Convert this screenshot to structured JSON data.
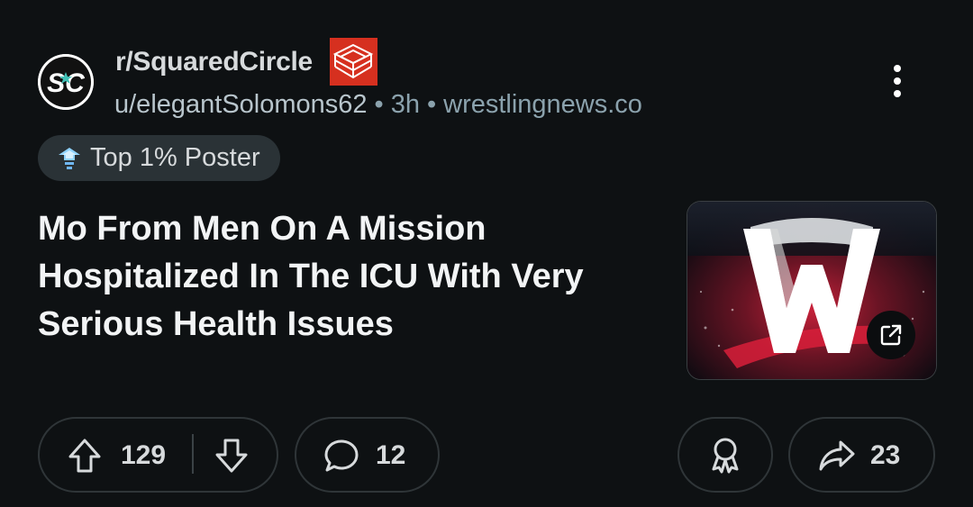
{
  "post": {
    "subreddit": "r/SquaredCircle",
    "author": "u/elegantSolomons62",
    "time": "3h",
    "domain": "wrestlingnews.co",
    "flair": "Top 1% Poster",
    "title": "Mo From Men On A Mission Hospitalized In The ICU With Very Serious Health Issues"
  },
  "actions": {
    "upvotes": "129",
    "comments": "12",
    "shares": "23"
  },
  "icons": {
    "avatar": "sc-logo-avatar",
    "subreddit_badge": "wrestling-ring-icon",
    "more": "more-vertical-icon",
    "flair": "top-poster-icon",
    "thumbnail_link": "external-link-icon",
    "upvote": "upvote-arrow-icon",
    "downvote": "downvote-arrow-icon",
    "comment": "comment-bubble-icon",
    "award": "award-icon",
    "share": "share-arrow-icon"
  },
  "colors": {
    "background": "#0e1113",
    "pill_border": "#2f3538",
    "flair_bg": "#2a3236",
    "badge_red": "#d6301f"
  }
}
